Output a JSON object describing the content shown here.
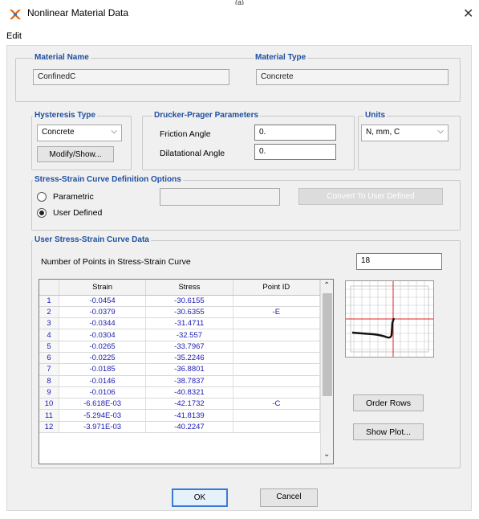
{
  "window": {
    "top_caption": "(a)",
    "title": "Nonlinear Material Data",
    "menu": [
      "Edit"
    ]
  },
  "material_name": {
    "label": "Material Name",
    "value": "ConfinedC"
  },
  "material_type": {
    "label": "Material Type",
    "value": "Concrete"
  },
  "hysteresis": {
    "label": "Hysteresis Type",
    "selected": "Concrete",
    "modify_button": "Modify/Show..."
  },
  "drucker_prager": {
    "label": "Drucker-Prager Parameters",
    "friction_angle_label": "Friction Angle",
    "friction_angle_value": "0.",
    "dilatational_angle_label": "Dilatational Angle",
    "dilatational_angle_value": "0."
  },
  "units": {
    "label": "Units",
    "selected": "N, mm, C"
  },
  "curve_options": {
    "label": "Stress-Strain Curve Definition Options",
    "parametric_label": "Parametric",
    "user_defined_label": "User Defined",
    "selected": "User Defined",
    "convert_button": "Convert To User Defined"
  },
  "curve_data": {
    "label": "User Stress-Strain Curve Data",
    "num_points_label": "Number of Points in Stress-Strain Curve",
    "num_points_value": "18",
    "columns": [
      "",
      "Strain",
      "Stress",
      "Point ID"
    ],
    "rows": [
      [
        "1",
        "-0.0454",
        "-30.6155",
        ""
      ],
      [
        "2",
        "-0.0379",
        "-30.6355",
        "-E"
      ],
      [
        "3",
        "-0.0344",
        "-31.4711",
        ""
      ],
      [
        "4",
        "-0.0304",
        "-32.557",
        ""
      ],
      [
        "5",
        "-0.0265",
        "-33.7967",
        ""
      ],
      [
        "6",
        "-0.0225",
        "-35.2246",
        ""
      ],
      [
        "7",
        "-0.0185",
        "-36.8801",
        ""
      ],
      [
        "8",
        "-0.0146",
        "-38.7837",
        ""
      ],
      [
        "9",
        "-0.0106",
        "-40.8321",
        ""
      ],
      [
        "10",
        "-6.618E-03",
        "-42.1732",
        "-C"
      ],
      [
        "11",
        "-5.294E-03",
        "-41.8139",
        ""
      ],
      [
        "12",
        "-3.971E-03",
        "-40.2247",
        ""
      ]
    ],
    "order_rows_button": "Order Rows",
    "show_plot_button": "Show Plot..."
  },
  "footer": {
    "ok_button": "OK",
    "cancel_button": "Cancel"
  },
  "colors": {
    "legend": "#1f4fa0",
    "table_text": "#1a1ab0",
    "title_icon": "#e06010",
    "plot_axis": "#e02020"
  }
}
